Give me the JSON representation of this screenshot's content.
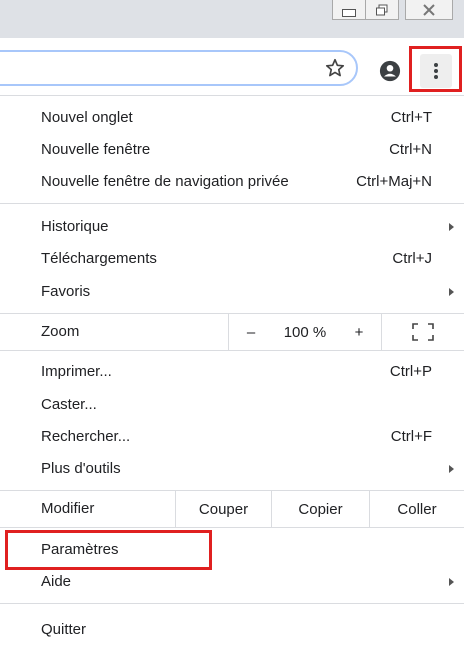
{
  "window": {
    "minimize_icon": "minimize-icon",
    "restore_icon": "restore-icon",
    "close_icon": "close-icon"
  },
  "toolbar": {
    "bookmark_icon": "star-icon",
    "profile_icon": "account-icon",
    "menu_icon": "three-dots-icon"
  },
  "menu": {
    "group1": [
      {
        "label": "Nouvel onglet",
        "shortcut": "Ctrl+T"
      },
      {
        "label": "Nouvelle fenêtre",
        "shortcut": "Ctrl+N"
      },
      {
        "label": "Nouvelle fenêtre de navigation privée",
        "shortcut": "Ctrl+Maj+N"
      }
    ],
    "group2": [
      {
        "label": "Historique",
        "shortcut": ""
      },
      {
        "label": "Téléchargements",
        "shortcut": "Ctrl+J"
      },
      {
        "label": "Favoris",
        "shortcut": ""
      }
    ],
    "zoom": {
      "label": "Zoom",
      "minus": "–",
      "value": "100 %",
      "plus": "+",
      "fullscreen_icon": "fullscreen-icon"
    },
    "group3": [
      {
        "label": "Imprimer...",
        "shortcut": "Ctrl+P"
      },
      {
        "label": "Caster...",
        "shortcut": ""
      },
      {
        "label": "Rechercher...",
        "shortcut": "Ctrl+F"
      },
      {
        "label": "Plus d'outils",
        "shortcut": ""
      }
    ],
    "edit": {
      "label": "Modifier",
      "cut": "Couper",
      "copy": "Copier",
      "paste": "Coller"
    },
    "group4": [
      {
        "label": "Paramètres",
        "shortcut": ""
      },
      {
        "label": "Aide",
        "shortcut": ""
      }
    ],
    "quit": {
      "label": "Quitter"
    }
  },
  "colors": {
    "highlight": "#e02020",
    "separator": "#dadce0"
  }
}
